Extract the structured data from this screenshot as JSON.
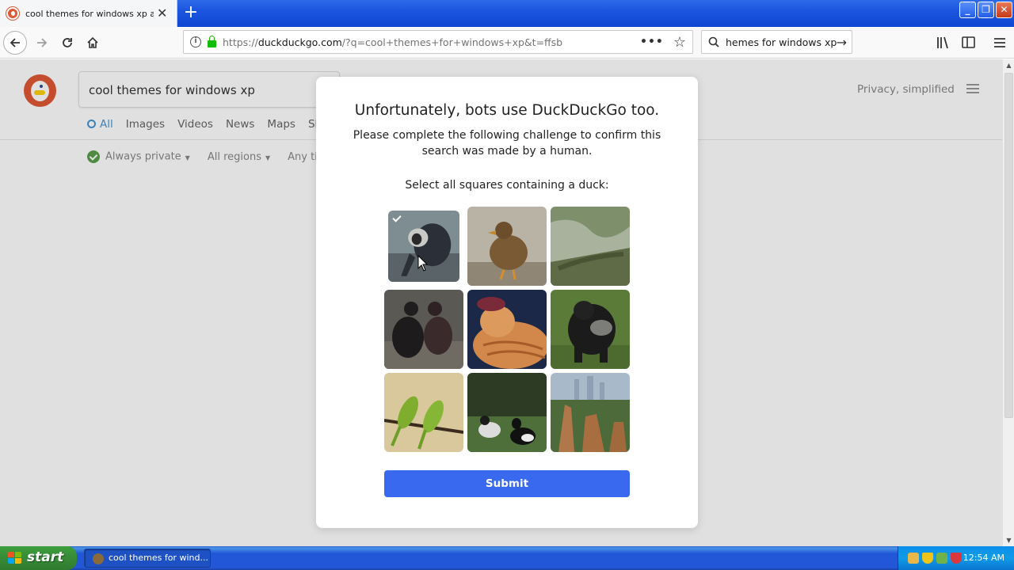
{
  "browser": {
    "tab_title": "cool themes for windows xp at DuckDuckGo",
    "tab_close": "✕",
    "new_tab": "+",
    "url_prefix": "https://",
    "url_host": "duckduckgo.com",
    "url_rest": "/?q=cool+themes+for+windows+xp&t=ffsb",
    "page_actions": "•••",
    "bookmark_star": "☆",
    "search_query": "hemes for windows xp",
    "search_go": "→",
    "window_minimize": "_",
    "window_maximize": "❐",
    "window_close": "✕"
  },
  "ddg": {
    "search_value": "cool themes for windows xp",
    "privacy_text": "Privacy, simplified",
    "tabs": [
      "All",
      "Images",
      "Videos",
      "News",
      "Maps",
      "Sh"
    ],
    "active_tab": "All",
    "filters": {
      "private": "Always private",
      "regions": "All regions",
      "time": "Any ti"
    }
  },
  "challenge": {
    "title": "Unfortunately, bots use DuckDuckGo too.",
    "subtitle": "Please complete the following challenge to confirm this search was made by a human.",
    "instruction": "Select all squares containing a duck:",
    "tiles": [
      {
        "subject": "monkey",
        "selected": true
      },
      {
        "subject": "duck",
        "selected": false
      },
      {
        "subject": "iguana",
        "selected": false
      },
      {
        "subject": "ducks",
        "selected": false
      },
      {
        "subject": "cat",
        "selected": false
      },
      {
        "subject": "gorilla",
        "selected": false
      },
      {
        "subject": "parrots",
        "selected": false
      },
      {
        "subject": "ducks",
        "selected": false
      },
      {
        "subject": "giraffes",
        "selected": false
      }
    ],
    "submit_label": "Submit"
  },
  "taskbar": {
    "start_label": "start",
    "task_label": "cool themes for wind...",
    "clock": "12:54 AM"
  },
  "colors": {
    "ddg_orange": "#de5833",
    "submit_blue": "#3969ef",
    "xp_blue": "#2257d7",
    "xp_green": "#388e38"
  }
}
